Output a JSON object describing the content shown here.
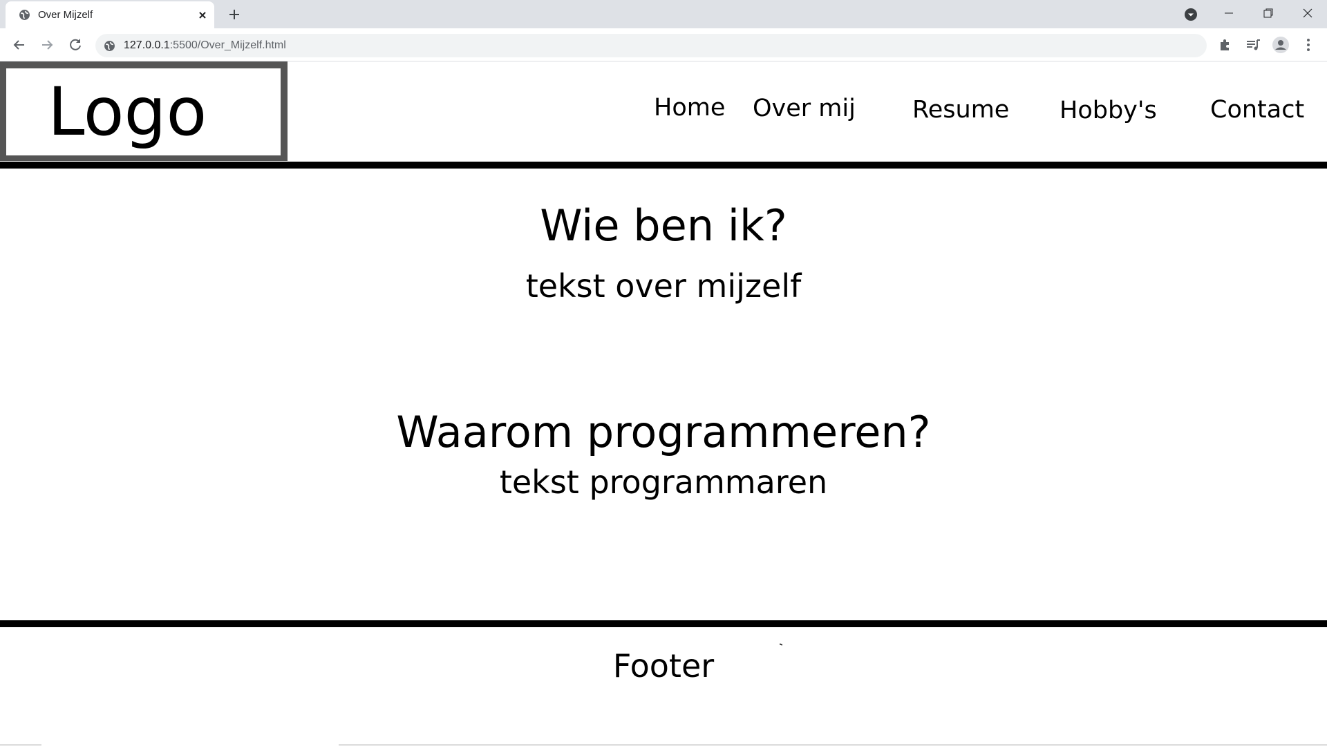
{
  "browser": {
    "tab_title": "Over Mijzelf",
    "url_host": "127.0.0.1",
    "url_rest": ":5500/Over_Mijzelf.html",
    "icons": {
      "favicon": "globe-icon",
      "tab_close": "close-icon",
      "new_tab": "plus-icon",
      "tab_search": "tab-search-icon",
      "minimize": "minimize-icon",
      "maximize": "restore-icon",
      "close_window": "close-icon",
      "back": "back-arrow-icon",
      "forward": "forward-arrow-icon",
      "reload": "reload-icon",
      "site_info": "globe-icon",
      "extensions": "puzzle-icon",
      "media": "media-queue-icon",
      "profile": "profile-icon",
      "menu": "kebab-menu-icon"
    }
  },
  "header": {
    "logo": "Logo",
    "nav": [
      {
        "label": "Home"
      },
      {
        "label": "Over mij"
      },
      {
        "label": "Resume"
      },
      {
        "label": "Hobby's"
      },
      {
        "label": "Contact"
      }
    ]
  },
  "main": {
    "sections": [
      {
        "heading": "Wie ben ik?",
        "text": "tekst over mijzelf"
      },
      {
        "heading": "Waarom programmeren?",
        "text": "tekst programmaren"
      }
    ]
  },
  "footer": {
    "text": "Footer"
  },
  "colors": {
    "logo_border": "#555555",
    "rule": "#000000",
    "tabstrip": "#dee1e6",
    "omnibox": "#f1f3f4"
  }
}
